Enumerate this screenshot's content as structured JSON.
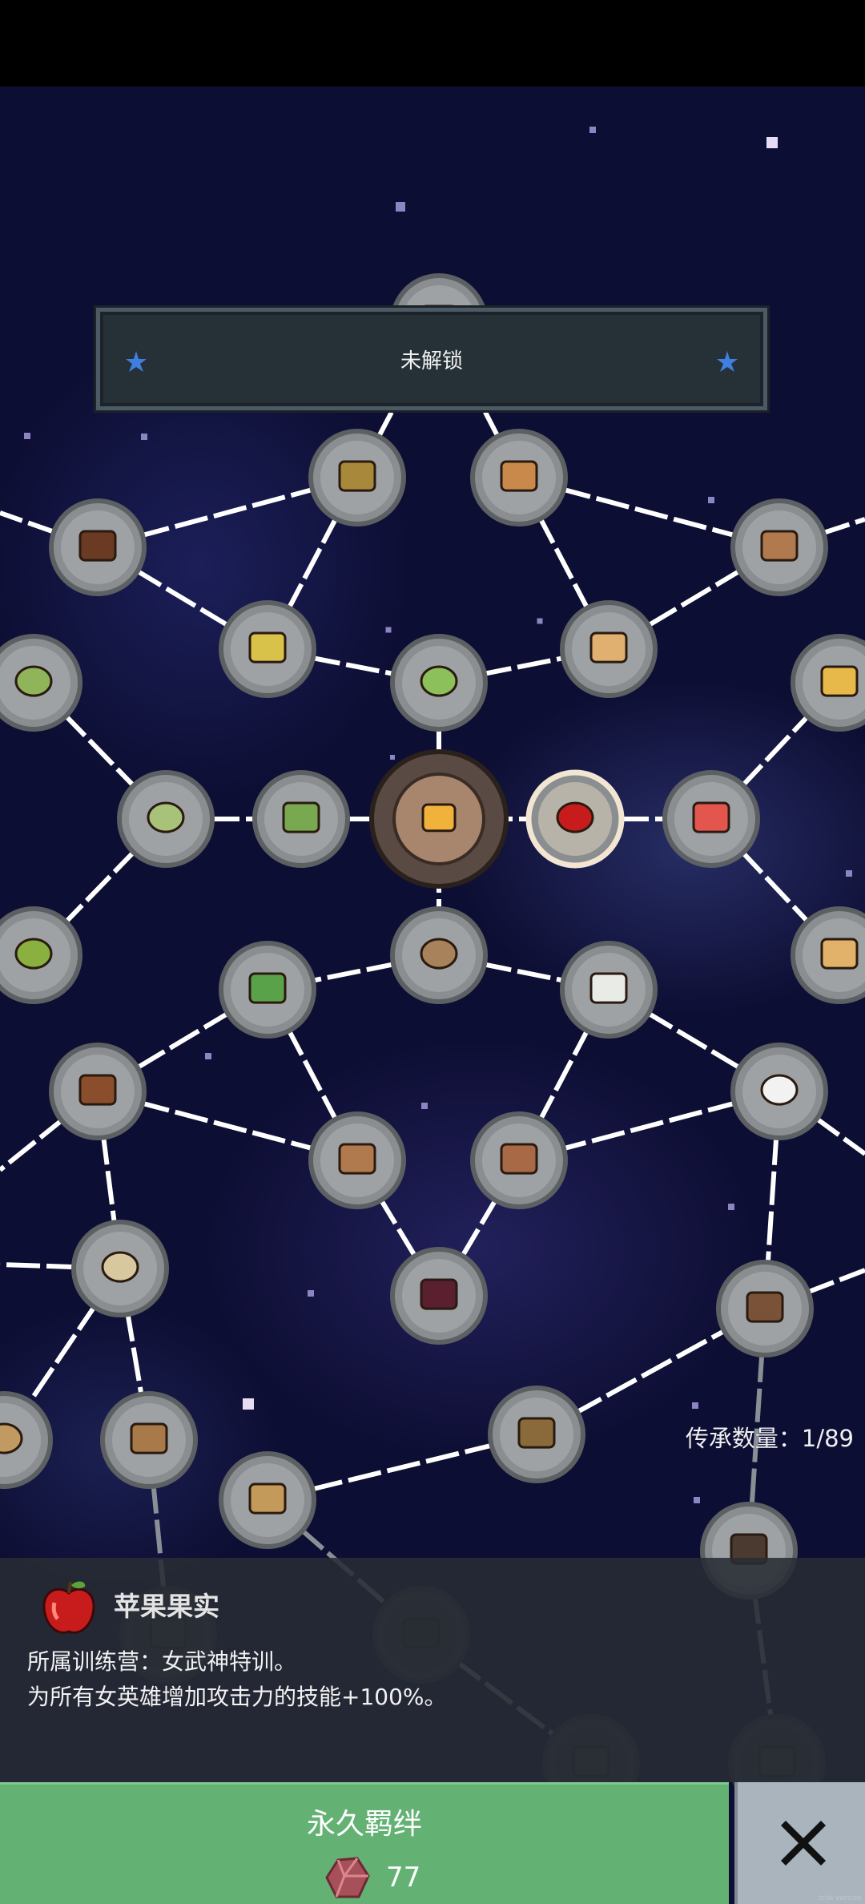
{
  "banner": {
    "text": "未解锁",
    "left_icon": "blue-star-icon",
    "right_icon": "blue-star-icon"
  },
  "legacy": {
    "label": "传承数量：",
    "value": "1/89"
  },
  "selected": {
    "name": "苹果果实",
    "camp_line": "所属训练营：女武神特训。",
    "effect_line": "为所有女英雄增加攻击力的技能+100%。",
    "icon": "apple-icon"
  },
  "bond_button": {
    "label": "永久羁绊",
    "cost": "77",
    "cost_icon": "red-gem-icon"
  },
  "close_button": {
    "icon": "close-x-icon"
  },
  "watermark": "trial version",
  "colors": {
    "space": "#0d0e33",
    "bond_button": "#63b274",
    "close_button": "#a9b4bc",
    "node_ring": "#6b6f70",
    "link": "#ffffff"
  },
  "nodes": [
    {
      "id": "cake-slice",
      "icon": "cake-slice-icon"
    },
    {
      "id": "skewer",
      "icon": "skewer-icon"
    },
    {
      "id": "burger",
      "icon": "burger-icon"
    },
    {
      "id": "sausage-skewer",
      "icon": "sausage-skewer-icon"
    },
    {
      "id": "jelly",
      "icon": "jelly-icon"
    },
    {
      "id": "corn",
      "icon": "corn-icon"
    },
    {
      "id": "cabbage",
      "icon": "cabbage-icon"
    },
    {
      "id": "bread",
      "icon": "bread-icon"
    },
    {
      "id": "pudding",
      "icon": "pudding-icon"
    },
    {
      "id": "coconut",
      "icon": "coconut-icon"
    },
    {
      "id": "leaf",
      "icon": "leaf-icon"
    },
    {
      "id": "honey-jar",
      "icon": "honey-jar-icon"
    },
    {
      "id": "apple",
      "icon": "apple-icon"
    },
    {
      "id": "watermelon",
      "icon": "watermelon-icon"
    },
    {
      "id": "kiwi",
      "icon": "kiwi-icon"
    },
    {
      "id": "bowl",
      "icon": "bowl-icon"
    },
    {
      "id": "pepper",
      "icon": "pepper-icon"
    },
    {
      "id": "radish",
      "icon": "radish-icon"
    },
    {
      "id": "pancakes",
      "icon": "pancakes-icon"
    },
    {
      "id": "loaf",
      "icon": "loaf-icon"
    },
    {
      "id": "onigiri",
      "icon": "onigiri-icon"
    },
    {
      "id": "fish",
      "icon": "fish-icon"
    },
    {
      "id": "steak",
      "icon": "steak-icon"
    },
    {
      "id": "donut",
      "icon": "donut-icon"
    },
    {
      "id": "wine",
      "icon": "wine-icon"
    },
    {
      "id": "wood",
      "icon": "wood-icon"
    },
    {
      "id": "round-left",
      "icon": "round-item-icon"
    },
    {
      "id": "shield",
      "icon": "shield-icon"
    },
    {
      "id": "brick",
      "icon": "brick-icon"
    },
    {
      "id": "stick",
      "icon": "stick-icon"
    },
    {
      "id": "dark-shard",
      "icon": "dark-shard-icon"
    },
    {
      "id": "dark-box",
      "icon": "dark-box-icon"
    },
    {
      "id": "top-hidden",
      "icon": "hidden-node-icon"
    },
    {
      "id": "bottom-left",
      "icon": "dark-item-icon"
    },
    {
      "id": "bottom-center",
      "icon": "dark-item-icon"
    },
    {
      "id": "bottom-right",
      "icon": "dark-item-icon"
    }
  ]
}
